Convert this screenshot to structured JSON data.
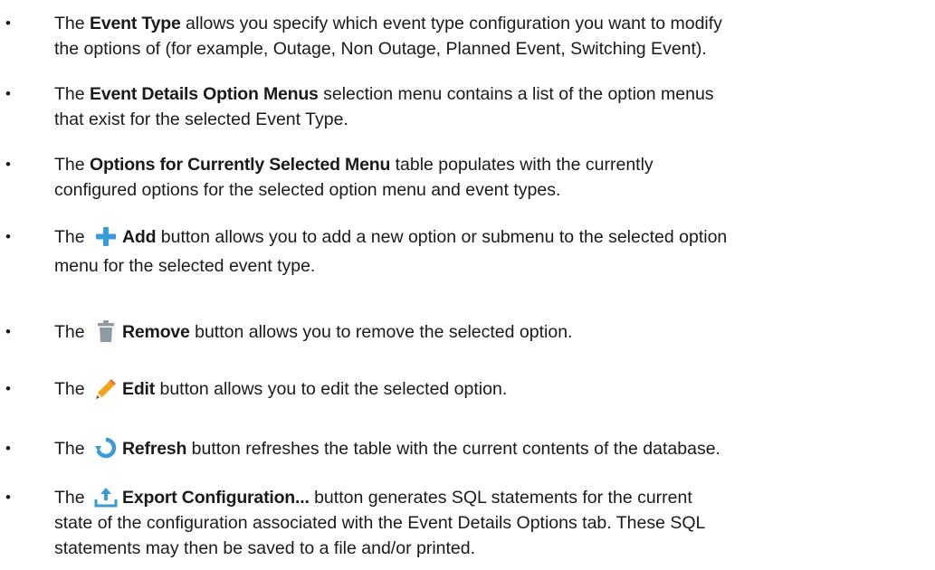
{
  "bullet_char": "•",
  "items": [
    {
      "lead": "The ",
      "bold": "Event Type",
      "line1_rest": " allows you specify which event type configuration you want to modify",
      "line2": "the options of (for example, Outage, Non Outage, Planned Event, Switching Event)."
    },
    {
      "lead": "The ",
      "bold": "Event Details Option Menus",
      "line1_rest": " selection menu contains a list of the option menus",
      "line2": "that exist for the selected Event Type."
    },
    {
      "lead": "The ",
      "bold": "Options for Currently Selected Menu",
      "line1_rest": " table populates with the currently",
      "line2": "configured options for the selected option menu and event types."
    },
    {
      "lead": "The ",
      "icon": "add-icon",
      "bold": "Add",
      "line1_rest": " button allows you to add a new option or submenu to the selected option",
      "line2": "menu for the selected event type."
    },
    {
      "lead": "The ",
      "icon": "trash-icon",
      "bold": "Remove",
      "line1_rest": " button allows you to remove the selected option."
    },
    {
      "lead": "The ",
      "icon": "pencil-icon",
      "bold": "Edit",
      "line1_rest": " button allows you to edit the selected option."
    },
    {
      "lead": "The ",
      "icon": "refresh-icon",
      "bold": "Refresh",
      "line1_rest": " button refreshes the table with the current contents of the database."
    },
    {
      "lead": "The ",
      "icon": "export-icon",
      "bold": "Export Configuration...",
      "line1_rest": " button generates SQL statements for the current",
      "line2": "state of the configuration associated with the Event Details Options tab. These SQL",
      "line3": "statements may then be saved to a file and/or printed."
    }
  ],
  "colors": {
    "text": "#1a1a1a",
    "add_icon": "#3a9bd9",
    "trash_icon": "#8e9aa3",
    "pencil_body": "#f2a51c",
    "refresh_icon": "#3a9bd9",
    "export_icon": "#3a9bd9"
  }
}
